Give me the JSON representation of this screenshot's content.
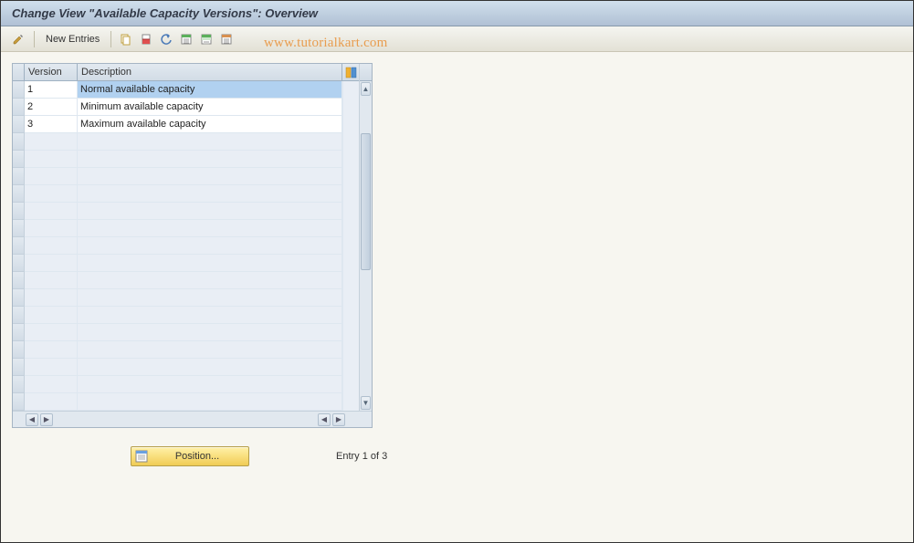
{
  "title": "Change View \"Available Capacity Versions\": Overview",
  "toolbar": {
    "new_entries_label": "New Entries"
  },
  "watermark": "www.tutorialkart.com",
  "table": {
    "columns": {
      "version": "Version",
      "description": "Description"
    },
    "rows": [
      {
        "version": "1",
        "description": "Normal available capacity",
        "selected": true
      },
      {
        "version": "2",
        "description": "Minimum available capacity",
        "selected": false
      },
      {
        "version": "3",
        "description": "Maximum available capacity",
        "selected": false
      }
    ],
    "empty_rows": 16
  },
  "footer": {
    "position_label": "Position...",
    "entry_status": "Entry 1 of 3"
  }
}
